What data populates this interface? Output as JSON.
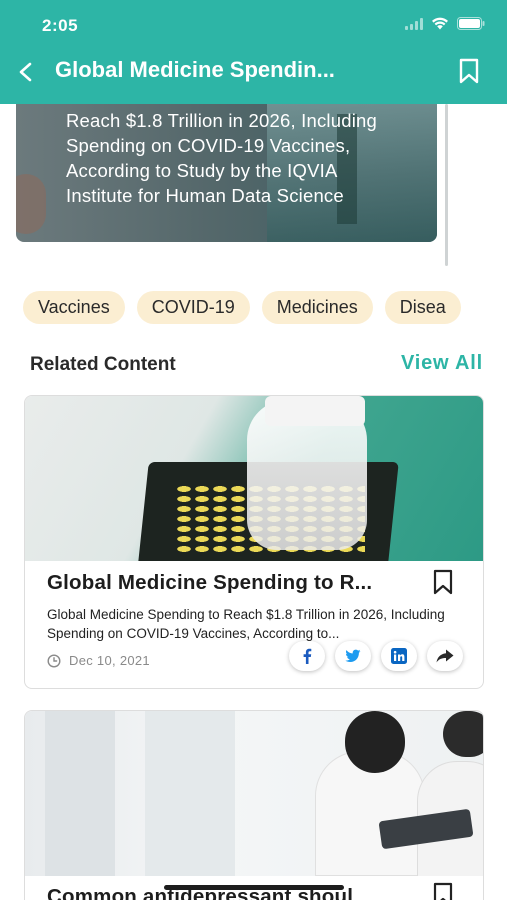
{
  "status_bar": {
    "time": "2:05"
  },
  "header": {
    "title": "Global Medicine Spendin..."
  },
  "hero": {
    "text": "Reach $1.8 Trillion in 2026, Including Spending on COVID-19 Vaccines, According to Study by the IQVIA Institute for Human Data Science"
  },
  "tags": [
    "Vaccines",
    "COVID-19",
    "Medicines",
    "Disea"
  ],
  "related": {
    "title": "Related Content",
    "view_all": "View All",
    "cards": [
      {
        "title": "Global Medicine Spending to R...",
        "description": "Global Medicine Spending to Reach $1.8 Trillion in 2026, Including Spending on COVID-19 Vaccines, According to...",
        "date": "Dec 10, 2021",
        "share": [
          "facebook",
          "twitter",
          "linkedin",
          "share"
        ]
      },
      {
        "title": "Common antidepressant shoul"
      }
    ]
  },
  "colors": {
    "accent": "#2db5a6",
    "tag_bg": "#fbeed2",
    "facebook": "#1b5bbf",
    "twitter": "#1d9bf0",
    "linkedin": "#0a66c2"
  }
}
